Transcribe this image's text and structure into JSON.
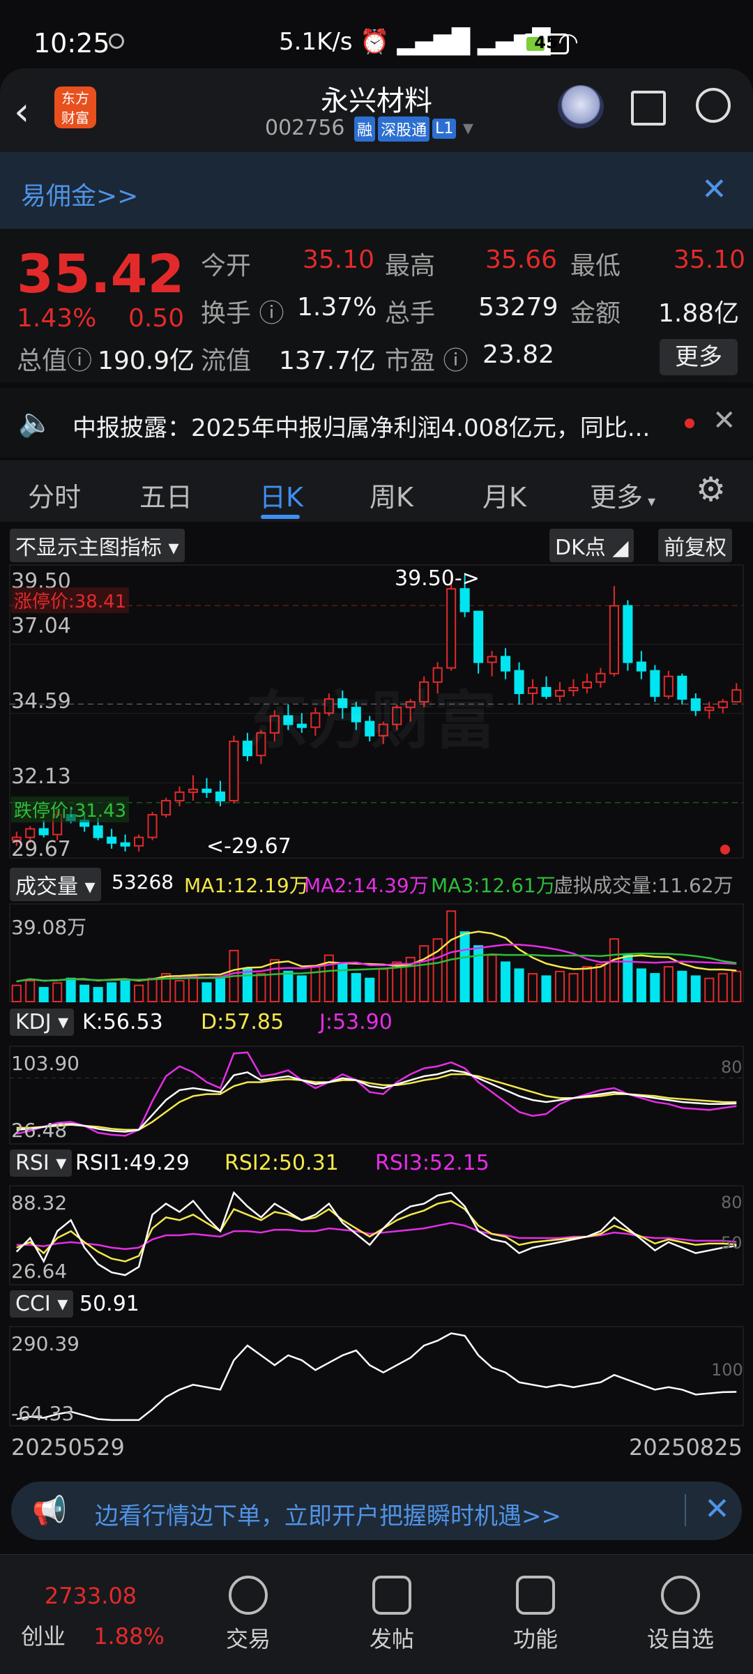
{
  "status_bar": {
    "time": "10:25",
    "network_speed": "5.1K/s",
    "battery": "45",
    "battery_level": 0.45
  },
  "header": {
    "title": "永兴材料",
    "code": "002756",
    "badges": [
      "融",
      "深股通",
      "L1"
    ],
    "logo_text": "东方财富"
  },
  "banner": {
    "text": "易佣金>>"
  },
  "quote": {
    "price": "35.42",
    "change_pct": "1.43%",
    "change": "0.50",
    "fields": [
      {
        "label": "今开",
        "value": "35.10"
      },
      {
        "label": "最高",
        "value": "35.66"
      },
      {
        "label": "最低",
        "value": "35.10"
      },
      {
        "label": "换手",
        "value": "1.37%"
      },
      {
        "label": "总手",
        "value": "53279"
      },
      {
        "label": "金额",
        "value": "1.88亿"
      },
      {
        "label": "总值",
        "value": "190.9亿"
      },
      {
        "label": "流值",
        "value": "137.7亿"
      },
      {
        "label": "市盈",
        "value": "23.82"
      }
    ],
    "more_label": "更多"
  },
  "notice": {
    "text": "中报披露：2025年中报归属净利润4.008亿元，同比..."
  },
  "tabs": [
    "分时",
    "五日",
    "日K",
    "周K",
    "月K",
    "更多"
  ],
  "chart": {
    "main_indicator_label": "不显示主图指标",
    "dk_label": "DK点",
    "adjust_label": "前复权",
    "y_ticks": [
      "39.50",
      "37.04",
      "34.59",
      "32.13",
      "29.67"
    ],
    "limit_up": "涨停价:38.41",
    "limit_down": "跌停价:31.43",
    "high_marker": "39.50->",
    "low_marker": "<-29.67",
    "volume": {
      "label": "成交量",
      "value": "53268",
      "ma1": "MA1:12.19万",
      "ma2": "MA2:14.39万",
      "ma3": "MA3:12.61万",
      "virtual": "虚拟成交量:11.62万",
      "max": "39.08万"
    },
    "kdj": {
      "label": "KDJ",
      "k": "K:56.53",
      "d": "D:57.85",
      "j": "J:53.90",
      "max": "103.90",
      "min": "26.48",
      "level": "80"
    },
    "rsi": {
      "label": "RSI",
      "r1": "RSI1:49.29",
      "r2": "RSI2:50.31",
      "r3": "RSI3:52.15",
      "max": "88.32",
      "min": "26.64",
      "level_hi": "80",
      "level_lo": "50"
    },
    "cci": {
      "label": "CCI",
      "value": "50.91",
      "max": "290.39",
      "min": "-64.33",
      "level": "100"
    },
    "date_start": "20250529",
    "date_end": "20250825",
    "watermark": "东方财富",
    "colors": {
      "up": "#e32a2a",
      "down": "#00e6f0",
      "ma1": "#f5e94a",
      "ma2": "#e62ee6",
      "ma3": "#2fbf3a"
    }
  },
  "chart_data": {
    "type": "candlestick",
    "candles": [
      [
        30.1,
        30.4,
        29.9,
        30.2
      ],
      [
        30.2,
        30.6,
        30.0,
        30.5
      ],
      [
        30.5,
        30.8,
        30.2,
        30.3
      ],
      [
        30.3,
        31.2,
        30.1,
        31.0
      ],
      [
        31.0,
        31.3,
        30.7,
        30.8
      ],
      [
        30.8,
        31.1,
        30.4,
        30.6
      ],
      [
        30.6,
        30.9,
        30.1,
        30.2
      ],
      [
        30.2,
        30.5,
        29.8,
        30.0
      ],
      [
        30.0,
        30.3,
        29.7,
        29.9
      ],
      [
        29.9,
        30.3,
        29.7,
        30.2
      ],
      [
        30.2,
        31.1,
        30.1,
        31.0
      ],
      [
        31.0,
        31.6,
        30.9,
        31.5
      ],
      [
        31.5,
        32.0,
        31.3,
        31.8
      ],
      [
        31.8,
        32.4,
        31.5,
        31.9
      ],
      [
        31.9,
        32.3,
        31.6,
        31.8
      ],
      [
        31.8,
        32.2,
        31.3,
        31.5
      ],
      [
        31.5,
        33.8,
        31.4,
        33.6
      ],
      [
        33.6,
        33.9,
        32.9,
        33.1
      ],
      [
        33.1,
        34.0,
        32.8,
        33.9
      ],
      [
        33.9,
        34.7,
        33.6,
        34.5
      ],
      [
        34.5,
        34.9,
        34.0,
        34.2
      ],
      [
        34.2,
        34.6,
        33.9,
        34.1
      ],
      [
        34.1,
        34.8,
        33.8,
        34.6
      ],
      [
        34.6,
        35.3,
        34.5,
        35.1
      ],
      [
        35.1,
        35.4,
        34.4,
        34.8
      ],
      [
        34.8,
        35.0,
        34.0,
        34.3
      ],
      [
        34.3,
        34.5,
        33.6,
        33.8
      ],
      [
        33.8,
        34.3,
        33.5,
        34.2
      ],
      [
        34.2,
        34.9,
        34.0,
        34.8
      ],
      [
        34.8,
        35.1,
        34.3,
        35.0
      ],
      [
        35.0,
        35.9,
        34.8,
        35.7
      ],
      [
        35.7,
        36.4,
        35.3,
        36.2
      ],
      [
        36.2,
        39.5,
        36.1,
        39.0
      ],
      [
        39.0,
        39.5,
        38.0,
        38.2
      ],
      [
        38.2,
        37.6,
        36.0,
        36.4
      ],
      [
        36.4,
        36.8,
        35.9,
        36.6
      ],
      [
        36.6,
        36.9,
        35.8,
        36.1
      ],
      [
        36.1,
        36.4,
        34.9,
        35.3
      ],
      [
        35.3,
        35.8,
        34.9,
        35.5
      ],
      [
        35.5,
        35.9,
        35.1,
        35.2
      ],
      [
        35.2,
        35.7,
        35.0,
        35.4
      ],
      [
        35.4,
        35.8,
        35.2,
        35.5
      ],
      [
        35.5,
        36.0,
        35.3,
        35.7
      ],
      [
        35.7,
        36.2,
        35.5,
        36.0
      ],
      [
        36.0,
        39.1,
        35.9,
        38.4
      ],
      [
        38.4,
        38.6,
        36.1,
        36.4
      ],
      [
        36.4,
        36.8,
        35.8,
        36.1
      ],
      [
        36.1,
        36.3,
        35.0,
        35.2
      ],
      [
        35.2,
        36.1,
        35.1,
        35.9
      ],
      [
        35.9,
        36.0,
        34.9,
        35.1
      ],
      [
        35.1,
        35.3,
        34.5,
        34.7
      ],
      [
        34.7,
        35.0,
        34.4,
        34.8
      ],
      [
        34.8,
        35.1,
        34.6,
        35.0
      ],
      [
        35.0,
        35.66,
        35.1,
        35.42
      ]
    ],
    "volume": [
      7,
      9,
      6,
      8,
      10,
      7,
      6,
      8,
      9,
      7,
      10,
      12,
      9,
      11,
      8,
      10,
      22,
      14,
      12,
      18,
      13,
      11,
      15,
      20,
      16,
      12,
      10,
      14,
      17,
      19,
      24,
      27,
      39,
      30,
      24,
      20,
      17,
      14,
      12,
      11,
      13,
      12,
      15,
      16,
      27,
      20,
      14,
      12,
      15,
      13,
      11,
      10,
      12,
      13
    ],
    "kdj": {
      "k": [
        30,
        31,
        33,
        35,
        36,
        34,
        31,
        29,
        28,
        30,
        45,
        60,
        70,
        72,
        70,
        68,
        85,
        88,
        80,
        82,
        84,
        80,
        76,
        78,
        82,
        80,
        74,
        72,
        76,
        80,
        84,
        86,
        90,
        88,
        82,
        76,
        70,
        64,
        60,
        58,
        60,
        62,
        64,
        66,
        68,
        66,
        64,
        62,
        60,
        58,
        57,
        56,
        56,
        56.53
      ],
      "d": [
        32,
        32,
        33,
        34,
        35,
        34,
        33,
        31,
        30,
        30,
        38,
        48,
        58,
        64,
        66,
        66,
        74,
        78,
        78,
        80,
        81,
        80,
        78,
        78,
        80,
        80,
        77,
        75,
        75,
        77,
        80,
        82,
        86,
        86,
        84,
        80,
        76,
        72,
        68,
        64,
        62,
        62,
        63,
        64,
        66,
        66,
        65,
        64,
        62,
        61,
        60,
        59,
        58,
        57.85
      ],
      "j": [
        26,
        29,
        33,
        37,
        38,
        34,
        27,
        25,
        24,
        30,
        59,
        84,
        94,
        88,
        78,
        72,
        107,
        108,
        84,
        86,
        90,
        80,
        72,
        78,
        86,
        80,
        68,
        66,
        78,
        86,
        92,
        94,
        98,
        92,
        78,
        68,
        58,
        48,
        44,
        46,
        56,
        62,
        66,
        70,
        72,
        66,
        62,
        58,
        56,
        52,
        51,
        50,
        52,
        53.9
      ]
    },
    "rsi": {
      "r1": [
        45,
        55,
        38,
        60,
        68,
        48,
        36,
        30,
        28,
        34,
        72,
        80,
        74,
        82,
        70,
        60,
        88,
        78,
        70,
        80,
        74,
        68,
        72,
        80,
        66,
        58,
        50,
        62,
        72,
        78,
        80,
        86,
        88,
        78,
        60,
        54,
        52,
        44,
        48,
        50,
        52,
        54,
        56,
        60,
        70,
        62,
        54,
        46,
        52,
        48,
        44,
        46,
        48,
        49.29
      ],
      "r2": [
        48,
        52,
        44,
        55,
        60,
        52,
        45,
        40,
        38,
        42,
        62,
        70,
        68,
        72,
        66,
        60,
        76,
        72,
        68,
        74,
        72,
        68,
        70,
        76,
        68,
        62,
        56,
        62,
        68,
        72,
        75,
        80,
        82,
        76,
        64,
        58,
        56,
        50,
        52,
        53,
        54,
        55,
        56,
        58,
        64,
        60,
        56,
        51,
        54,
        52,
        50,
        51,
        51,
        50.31
      ],
      "r3": [
        50,
        50,
        49,
        51,
        52,
        51,
        50,
        48,
        47,
        48,
        54,
        57,
        57,
        58,
        57,
        56,
        60,
        60,
        59,
        61,
        61,
        60,
        60,
        62,
        61,
        60,
        58,
        59,
        60,
        61,
        62,
        64,
        66,
        64,
        60,
        58,
        57,
        55,
        55,
        55,
        55,
        56,
        56,
        57,
        59,
        58,
        56,
        55,
        55,
        54,
        53,
        53,
        53,
        52.15
      ]
    },
    "cci": [
      -60,
      -50,
      -55,
      -40,
      -30,
      -45,
      -60,
      -64,
      -64,
      -64,
      -20,
      30,
      60,
      80,
      70,
      60,
      180,
      240,
      200,
      160,
      200,
      180,
      140,
      170,
      200,
      220,
      160,
      130,
      160,
      190,
      240,
      260,
      290,
      280,
      200,
      150,
      130,
      90,
      80,
      70,
      80,
      70,
      80,
      90,
      120,
      100,
      80,
      60,
      70,
      60,
      40,
      45,
      50,
      50.91
    ],
    "ylim": [
      29.67,
      39.5
    ]
  },
  "cta": {
    "text": "边看行情边下单，立即开户把握瞬时机遇>>"
  },
  "bottom_nav": {
    "index_value": "2733.08",
    "index_name": "创业",
    "index_change": "1.88%",
    "items": [
      "交易",
      "发帖",
      "功能",
      "设自选"
    ]
  }
}
